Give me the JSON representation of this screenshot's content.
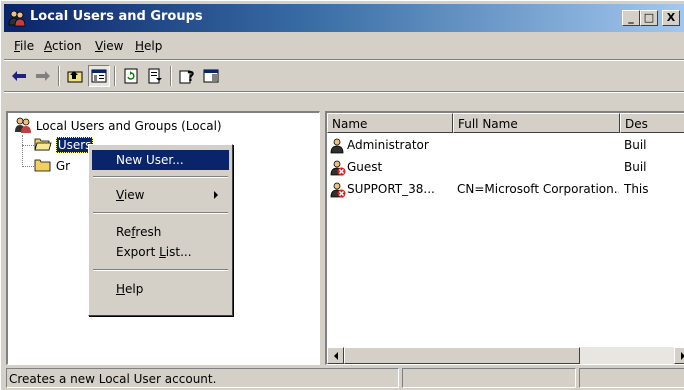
{
  "window": {
    "title": "Local Users and Groups",
    "minimize_glyph": "_",
    "maximize_glyph": "□",
    "close_glyph": "X"
  },
  "menubar": {
    "file": {
      "accel": "F",
      "rest": "ile"
    },
    "action": {
      "accel": "A",
      "rest": "ction"
    },
    "view": {
      "accel": "V",
      "rest": "iew"
    },
    "help": {
      "accel": "H",
      "rest": "elp"
    }
  },
  "toolbar": {
    "icons": [
      "back-arrow-icon",
      "forward-arrow-icon",
      "up-one-level-icon",
      "show-hide-tree-icon",
      "refresh-icon",
      "export-list-icon",
      "help-icon",
      "show-hide-action-pane-icon"
    ]
  },
  "tree": {
    "root_label": "Local Users and Groups (Local)",
    "users_label": "Users",
    "groups_label": "Gr"
  },
  "list": {
    "columns": [
      "Name",
      "Full Name",
      "Des"
    ],
    "rows": [
      {
        "name": "Administrator",
        "full_name": "",
        "description": "Buil",
        "disabled": false
      },
      {
        "name": "Guest",
        "full_name": "",
        "description": "Buil",
        "disabled": true
      },
      {
        "name": "SUPPORT_38...",
        "full_name": "CN=Microsoft Corporation...",
        "description": "This",
        "disabled": true
      }
    ]
  },
  "context_menu": {
    "new_user": "New User...",
    "view": {
      "accel": "V",
      "rest": "iew"
    },
    "refresh": {
      "pre": "Re",
      "accel": "f",
      "rest": "resh"
    },
    "export": {
      "pre": "Export ",
      "accel": "L",
      "rest": "ist..."
    },
    "help": {
      "accel": "H",
      "rest": "elp"
    }
  },
  "statusbar": {
    "message": "Creates a new Local User account."
  },
  "colors": {
    "title_gradient_start": "#0a246a",
    "title_gradient_end": "#a6caf0",
    "selection": "#0a246a",
    "face": "#d4d0c8"
  }
}
